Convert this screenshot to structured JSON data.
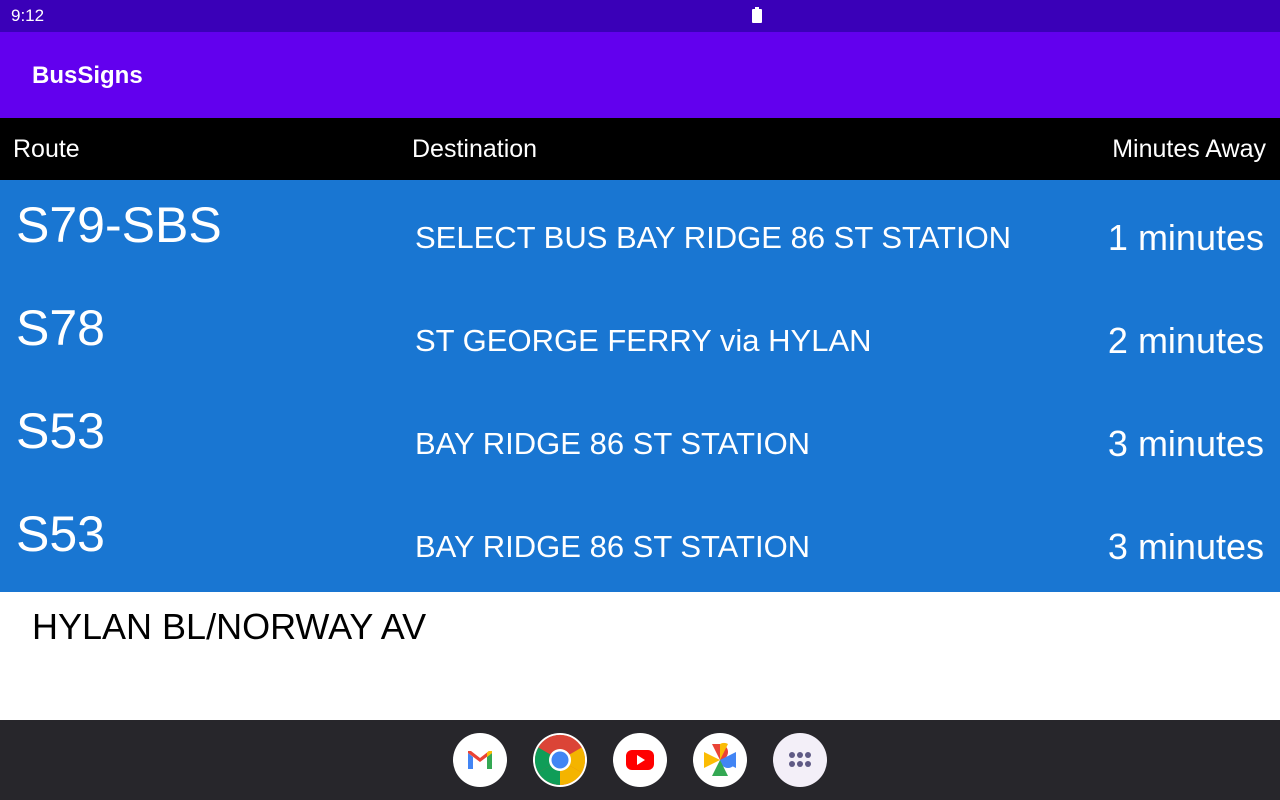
{
  "status_bar": {
    "time": "9:12"
  },
  "app_bar": {
    "title": "BusSigns"
  },
  "table": {
    "headers": {
      "route": "Route",
      "destination": "Destination",
      "minutes": "Minutes Away"
    },
    "rows": [
      {
        "route": "S79-SBS",
        "destination": "SELECT BUS BAY RIDGE 86 ST STATION",
        "minutes": "1 minutes"
      },
      {
        "route": "S78",
        "destination": "ST GEORGE FERRY via HYLAN",
        "minutes": "2 minutes"
      },
      {
        "route": "S53",
        "destination": "BAY RIDGE 86 ST STATION",
        "minutes": "3 minutes"
      },
      {
        "route": "S53",
        "destination": "BAY RIDGE 86 ST STATION",
        "minutes": "3 minutes"
      }
    ]
  },
  "stop": {
    "name": "HYLAN BL/NORWAY AV"
  },
  "dock": {
    "apps": [
      "gmail-icon",
      "chrome-icon",
      "youtube-icon",
      "photos-icon",
      "app-drawer-icon"
    ]
  },
  "colors": {
    "status_bar": "#3a00b8",
    "app_bar": "#6200ee",
    "table_header": "#000000",
    "rows_bg": "#1976d2",
    "nav_bar": "#27262b"
  }
}
